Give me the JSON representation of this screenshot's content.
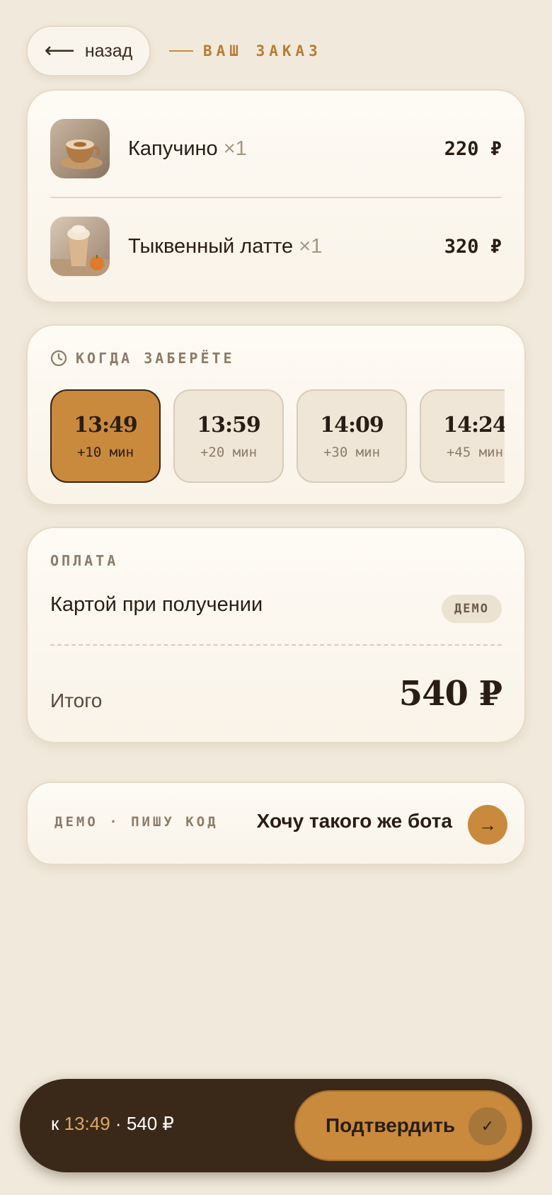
{
  "header": {
    "back_label": "назад",
    "back_icon": "arrow-left-icon",
    "title": "ВАШ ЗАКАЗ"
  },
  "order": {
    "items": [
      {
        "name": "Капучино",
        "qty": "×1",
        "price": "220 ₽",
        "image": "cappuccino-photo"
      },
      {
        "name": "Тыквенный латте",
        "qty": "×1",
        "price": "320 ₽",
        "image": "pumpkin-latte-photo"
      }
    ]
  },
  "pickup": {
    "label": "КОГДА ЗАБЕРЁТЕ",
    "icon": "clock-icon",
    "slots": [
      {
        "time": "13:49",
        "delta": "+10 мин",
        "selected": true
      },
      {
        "time": "13:59",
        "delta": "+20 мин",
        "selected": false
      },
      {
        "time": "14:09",
        "delta": "+30 мин",
        "selected": false
      },
      {
        "time": "14:24",
        "delta": "+45 мин",
        "selected": false
      }
    ]
  },
  "payment": {
    "label": "ОПЛАТА",
    "method": "Картой при получении",
    "badge": "ДЕМО",
    "total_label": "Итого",
    "total_value": "540 ₽"
  },
  "promo": {
    "small": "ДЕМО · ПИШУ КОД",
    "cta": "Хочу такого же бота",
    "icon": "arrow-right-icon"
  },
  "bottom_bar": {
    "prefix": "к",
    "time": "13:49",
    "separator": "·",
    "total": "540 ₽",
    "confirm_label": "Подтвердить",
    "confirm_icon": "check-icon"
  },
  "colors": {
    "background": "#f1e9dc",
    "accent": "#c98a3e",
    "dark": "#3a2919",
    "text": "#2a1d14",
    "muted": "#8c7c69"
  }
}
